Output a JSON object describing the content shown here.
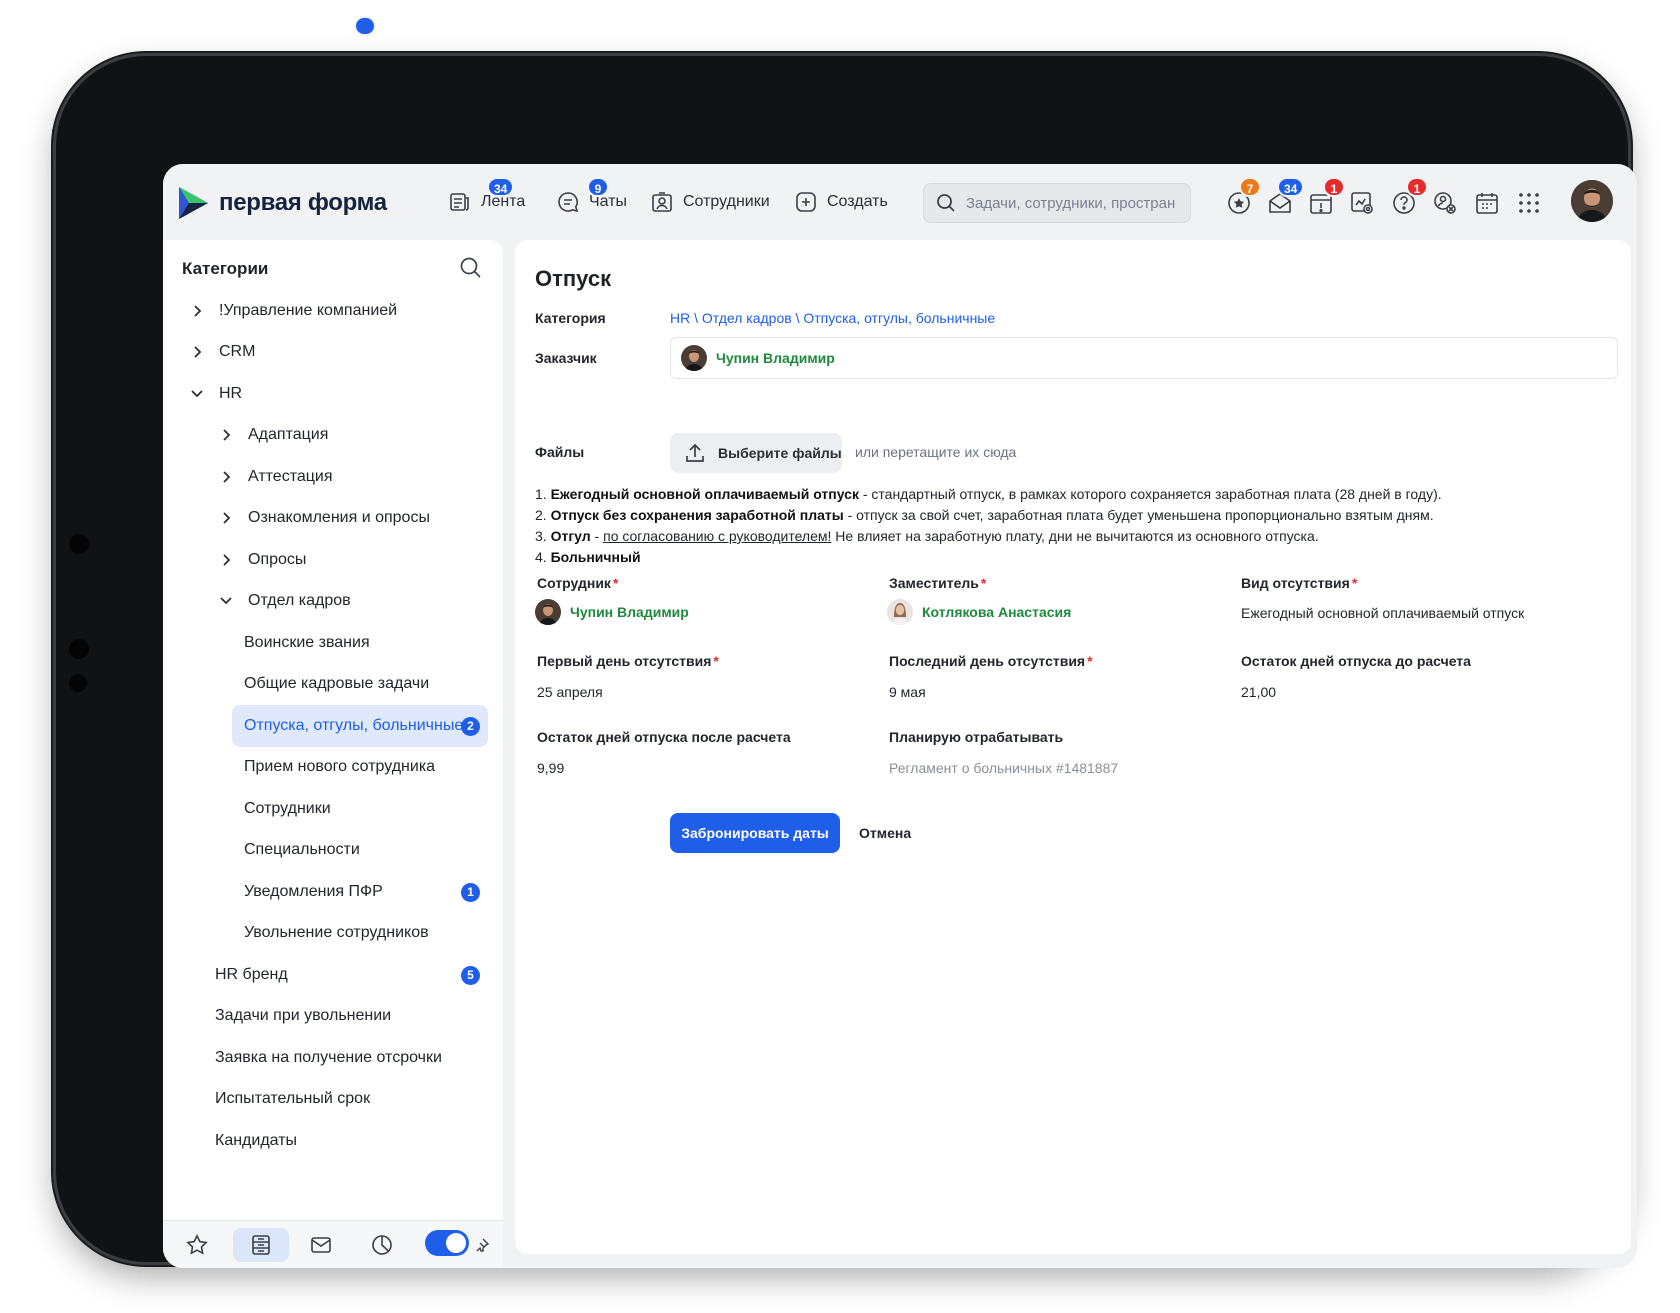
{
  "app": {
    "brand": "первая форма",
    "nav": [
      {
        "label": "Лента",
        "badge": "34"
      },
      {
        "label": "Чаты",
        "badge": "9"
      },
      {
        "label": "Сотрудники"
      },
      {
        "label": "Создать"
      }
    ],
    "search_placeholder": "Задачи, сотрудники, пространства",
    "right_icons": [
      {
        "icon": "star-bubble-icon",
        "badge": "7",
        "badge_color": "#ec7a17"
      },
      {
        "icon": "mail-open-icon",
        "badge": "34",
        "badge_color": "#1f5ee8"
      },
      {
        "icon": "alert-calendar-icon",
        "badge": "1",
        "badge_color": "#e52b2b"
      },
      {
        "icon": "chart-settings-icon"
      },
      {
        "icon": "help-icon",
        "badge": "1",
        "badge_color": "#e52b2b"
      },
      {
        "icon": "gear-user-icon"
      },
      {
        "icon": "calendar-icon"
      },
      {
        "icon": "grid-dots-icon"
      }
    ]
  },
  "sidebar": {
    "title": "Категории",
    "items": [
      {
        "label": "!Управление компанией",
        "level": 0,
        "chevron": "right"
      },
      {
        "label": "CRM",
        "level": 0,
        "chevron": "right"
      },
      {
        "label": "HR",
        "level": 0,
        "chevron": "down"
      },
      {
        "label": "Адаптация",
        "level": 1,
        "chevron": "right"
      },
      {
        "label": "Аттестация",
        "level": 1,
        "chevron": "right"
      },
      {
        "label": "Ознакомления и опросы",
        "level": 1,
        "chevron": "right"
      },
      {
        "label": "Опросы",
        "level": 1,
        "chevron": "right"
      },
      {
        "label": "Отдел кадров",
        "level": 1,
        "chevron": "down"
      },
      {
        "label": "Воинские звания",
        "level": 2
      },
      {
        "label": "Общие кадровые задачи",
        "level": 2
      },
      {
        "label": "Отпуска, отгулы, больничные",
        "level": 2,
        "count": "2",
        "active": true
      },
      {
        "label": "Прием нового сотрудника",
        "level": 2
      },
      {
        "label": "Сотрудники",
        "level": 2
      },
      {
        "label": "Специальности",
        "level": 2
      },
      {
        "label": "Уведомления ПФР",
        "level": 2,
        "count": "1"
      },
      {
        "label": "Увольнение сотрудников",
        "level": 2
      },
      {
        "label": "HR бренд",
        "level": 1,
        "count": "5"
      },
      {
        "label": "Задачи при увольнении",
        "level": 1
      },
      {
        "label": "Заявка на получение отсрочки",
        "level": 1
      },
      {
        "label": "Испытательный срок",
        "level": 1
      },
      {
        "label": "Кандидаты",
        "level": 1
      }
    ]
  },
  "form": {
    "title": "Отпуск",
    "category_label": "Категория",
    "category_value": "HR \\ Отдел кадров \\ Отпуска, отгулы, больничные",
    "customer_label": "Заказчик",
    "customer_value": "Чупин Владимир",
    "files_label": "Файлы",
    "upload_button": "Выберите файлы",
    "upload_hint": "или перетащите их сюда",
    "rules": {
      "r1_num": "1.",
      "r1_bold": "Ежегодный основной оплачиваемый отпуск",
      "r1_text": " - стандартный отпуск, в рамках которого сохраняется заработная плата (28 дней в году).",
      "r2_num": "2.",
      "r2_bold": "Отпуск без сохранения заработной платы",
      "r2_text": " - отпуск за свой счет, заработная плата будет уменьшена пропорционально взятым дням.",
      "r3_num": "3.",
      "r3_bold": "Отгул",
      "r3_dash": " - ",
      "r3_link": "по согласованию с руководителем!",
      "r3_text": " Не влияет на заработную плату, дни не вычитаются из основного отпуска.",
      "r4_num": "4.",
      "r4_bold": "Больничный"
    },
    "employee_label": "Сотрудник",
    "employee_value": "Чупин Владимир",
    "deputy_label": "Заместитель",
    "deputy_value": "Котлякова Анастасия",
    "absence_type_label": "Вид отсутствия",
    "absence_type_value": "Ежегодный основной оплачиваемый отпуск",
    "first_day_label": "Первый день отсутствия",
    "first_day_value": "25 апреля",
    "last_day_label": "Последний день отсутствия",
    "last_day_value": "9 мая",
    "balance_before_label": "Остаток дней отпуска до расчета",
    "balance_before_value": "21,00",
    "balance_after_label": "Остаток дней отпуска после расчета",
    "balance_after_value": "9,99",
    "workoff_label": "Планирую отрабатывать",
    "workoff_placeholder": "Регламент о больничных #1481887",
    "required_mark": "*",
    "submit_button": "Забронировать даты",
    "cancel_button": "Отмена"
  },
  "colors": {
    "accent": "#1f5ee8",
    "person_link": "#1e8a3e",
    "required": "#e52b2b",
    "active_item_bg": "#dfe9fb"
  }
}
